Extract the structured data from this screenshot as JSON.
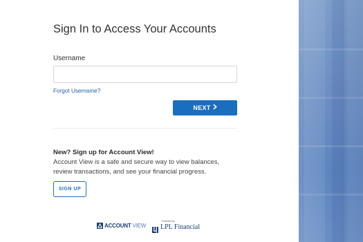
{
  "page": {
    "title": "Sign In to Access Your Accounts"
  },
  "form": {
    "username_label": "Username",
    "username_value": "",
    "username_placeholder": "",
    "forgot_username": "Forgot Username?",
    "next_label": "NEXT",
    "next_icon": "chevron-right-icon"
  },
  "signup": {
    "heading": "New? Sign up for Account View!",
    "description": "Account View is a safe and secure way to view balances, review transactions, and see your financial progress.",
    "button_label": "SIGN UP"
  },
  "footer": {
    "account_view_logo": {
      "bold": "ACCOUNT",
      "light": "VIEW"
    },
    "powered_by": "Powered by",
    "lpl_logo": "LPL Financial"
  },
  "colors": {
    "accent": "#1a6ec0",
    "link": "#1f5fa8",
    "brand_navy": "#1d3f75",
    "side_panel": "#6c8fc4"
  }
}
